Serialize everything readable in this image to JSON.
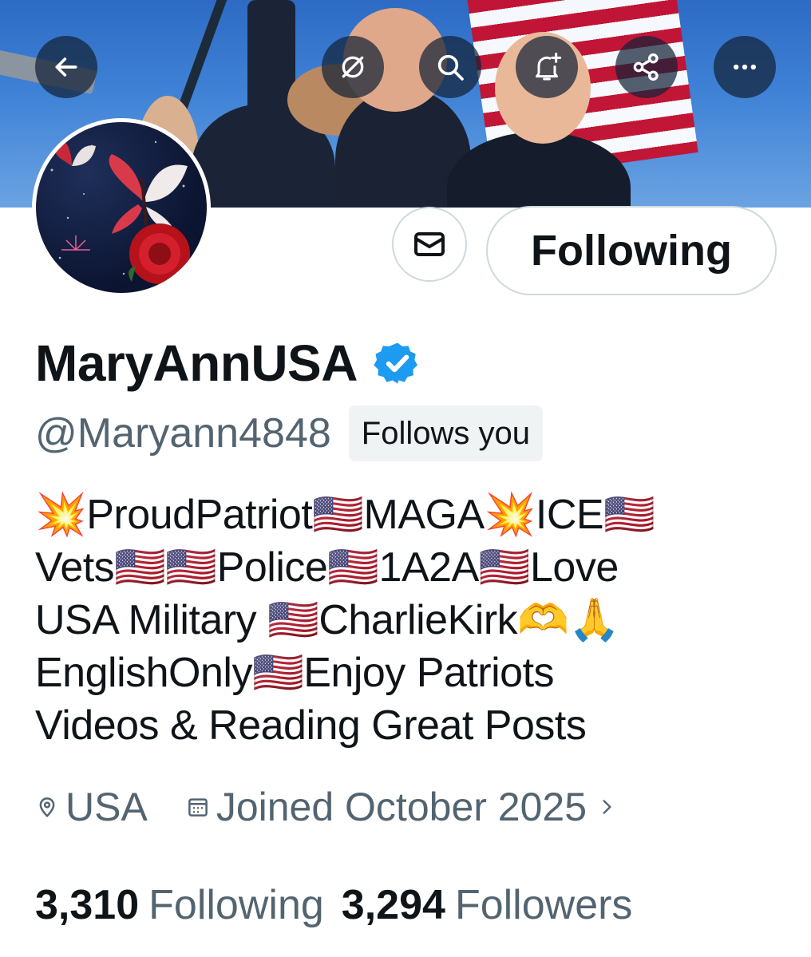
{
  "toolbar": {
    "back_icon": "arrow-left-icon",
    "grok_icon": "grok-icon",
    "search_icon": "search-icon",
    "notify_icon": "bell-plus-icon",
    "share_icon": "share-icon",
    "more_icon": "more-icon"
  },
  "profile": {
    "display_name": "MaryAnnUSA",
    "verified": true,
    "handle": "@Maryann4848",
    "follows_you_label": "Follows you",
    "follow_button_label": "Following",
    "bio": "💥ProudPatriot🇺🇸MAGA💥ICE🇺🇸\nVets🇺🇸🇺🇸Police🇺🇸1A2A🇺🇸Love\nUSA Military 🇺🇸CharlieKirk🫶🙏\nEnglishOnly🇺🇸Enjoy Patriots\nVideos & Reading Great Posts",
    "location": "USA",
    "joined": "Joined October 2025",
    "following_count": "3,310",
    "following_label": "Following",
    "followers_count": "3,294",
    "followers_label": "Followers"
  },
  "colors": {
    "accent": "#1d9bf0",
    "secondary_text": "#536471",
    "border": "#cfd9de"
  }
}
